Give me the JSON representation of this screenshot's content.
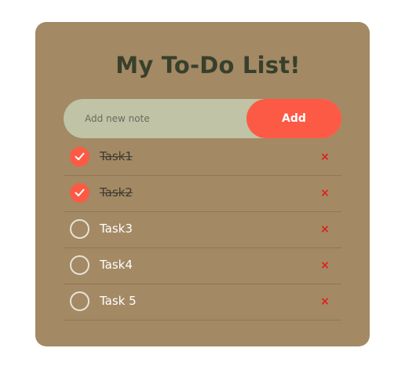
{
  "app": {
    "title": "My To-Do List!"
  },
  "input": {
    "placeholder": "Add new note",
    "value": ""
  },
  "add_button": {
    "label": "Add"
  },
  "tasks": [
    {
      "label": "Task1",
      "completed": true
    },
    {
      "label": "Task2",
      "completed": true
    },
    {
      "label": "Task3",
      "completed": false
    },
    {
      "label": "Task4",
      "completed": false
    },
    {
      "label": "Task 5",
      "completed": false
    }
  ],
  "icons": {
    "check": "check-icon",
    "delete": "close-icon",
    "delete_glyph": "×"
  },
  "colors": {
    "card_background": "#a38964",
    "accent": "#fc5a45",
    "input_background": "#c0c3a5",
    "title": "#38402c",
    "delete": "#e0201a"
  }
}
